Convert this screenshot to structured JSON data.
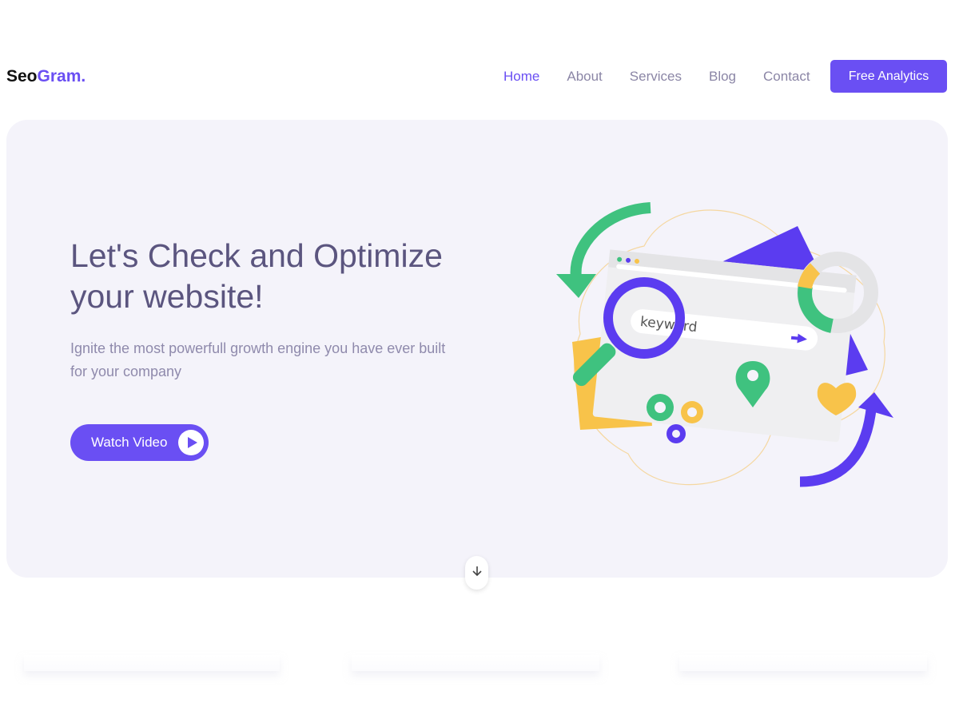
{
  "logo": {
    "part1": "Seo",
    "part2": "Gram",
    "dot": "."
  },
  "nav": {
    "items": [
      {
        "label": "Home",
        "active": true
      },
      {
        "label": "About"
      },
      {
        "label": "Services"
      },
      {
        "label": "Blog"
      },
      {
        "label": "Contact"
      }
    ],
    "cta_label": "Free Analytics"
  },
  "hero": {
    "title": "Let's Check and Optimize your website!",
    "subtitle": "Ignite the most powerfull growth engine you have ever built for your company",
    "button_label": "Watch Video",
    "search_keyword": "keyword"
  },
  "colors": {
    "accent": "#6a4ff3",
    "green": "#3fc27f",
    "yellow": "#f8c34a",
    "hero_bg": "#f4f3fa"
  },
  "icons": {
    "play": "play-icon",
    "scroll": "arrow-down-icon"
  }
}
